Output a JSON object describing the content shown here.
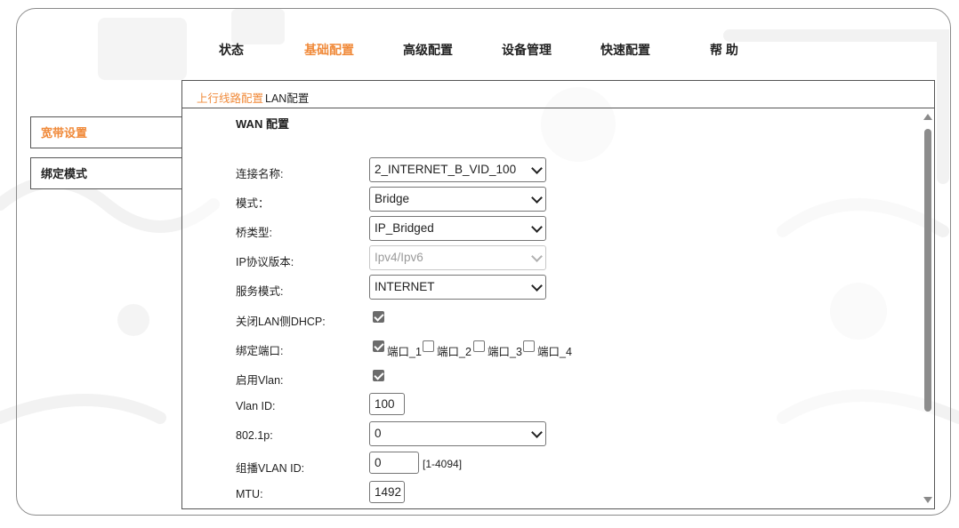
{
  "colors": {
    "accent": "#f08a3a",
    "text": "#222222",
    "border": "#555555"
  },
  "topnav": {
    "items": [
      {
        "label": "状态",
        "active": false
      },
      {
        "label": "基础配置",
        "active": true
      },
      {
        "label": "高级配置",
        "active": false
      },
      {
        "label": "设备管理",
        "active": false
      },
      {
        "label": "快速配置",
        "active": false
      },
      {
        "label": "帮 助",
        "active": false
      }
    ]
  },
  "sidebar": {
    "items": [
      {
        "label": "宽带设置",
        "active": true
      },
      {
        "label": "绑定模式",
        "active": false
      }
    ]
  },
  "subtabs": {
    "items": [
      {
        "label": "上行线路配置",
        "active": true
      },
      {
        "label": "LAN配置",
        "active": false
      }
    ]
  },
  "form": {
    "title": "WAN 配置",
    "connection_name": {
      "label": "连接名称:",
      "value": "2_INTERNET_B_VID_100"
    },
    "mode": {
      "label": "模式：",
      "value": "Bridge"
    },
    "bridge_type": {
      "label": "桥类型:",
      "value": "IP_Bridged"
    },
    "ip_version": {
      "label": "IP协议版本:",
      "value": "Ipv4/Ipv6"
    },
    "service_mode": {
      "label": "服务模式:",
      "value": "INTERNET"
    },
    "disable_lan_dhcp": {
      "label": "关闭LAN侧DHCP:",
      "checked": true
    },
    "bind_ports": {
      "label": "绑定端口:",
      "ports": [
        {
          "label": "端口_1",
          "checked": true
        },
        {
          "label": "端口_2",
          "checked": false
        },
        {
          "label": "端口_3",
          "checked": false
        },
        {
          "label": "端口_4",
          "checked": false
        }
      ]
    },
    "enable_vlan": {
      "label": "启用Vlan:",
      "checked": true
    },
    "vlan_id": {
      "label": "Vlan ID:",
      "value": "100"
    },
    "priority_8021p": {
      "label": "802.1p:",
      "value": "0"
    },
    "multicast_vlan_id": {
      "label": "组播VLAN ID:",
      "value": "0",
      "hint": "[1-4094]"
    },
    "mtu": {
      "label": "MTU:",
      "value": "1492"
    }
  }
}
